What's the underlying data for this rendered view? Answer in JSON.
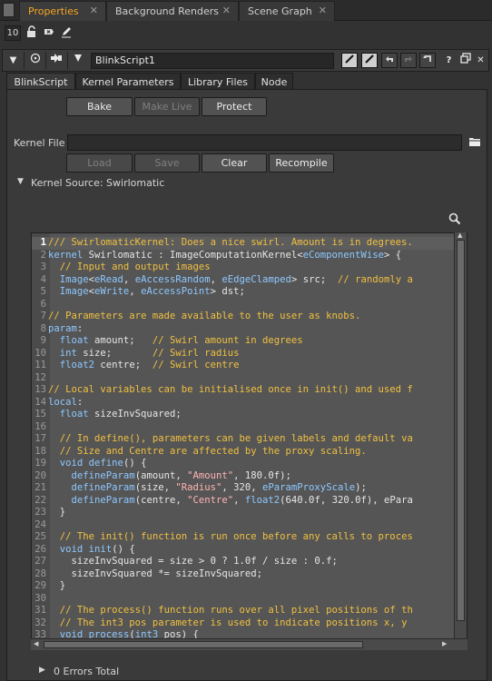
{
  "panel_tabs": [
    {
      "label": "Properties",
      "active": true
    },
    {
      "label": "Background Renders",
      "active": false
    },
    {
      "label": "Scene Graph",
      "active": false
    }
  ],
  "toolbar": {
    "max_panels": "10"
  },
  "node": {
    "name": "BlinkScript1"
  },
  "content_tabs": [
    "BlinkScript",
    "Kernel Parameters",
    "Library Files",
    "Node"
  ],
  "buttons": {
    "bake": "Bake",
    "make_live": "Make Live",
    "protect": "Protect",
    "load": "Load",
    "save": "Save",
    "clear": "Clear",
    "recompile": "Recompile"
  },
  "kernel_file": {
    "label": "Kernel File",
    "value": ""
  },
  "kernel_source": {
    "label": "Kernel Source: Swirlomatic"
  },
  "code_lines": [
    "/// SwirlomaticKernel: Does a nice swirl. Amount is in degrees.",
    "kernel Swirlomatic : ImageComputationKernel<eComponentWise> {",
    "  // Input and output images",
    "  Image<eRead, eAccessRandom, eEdgeClamped> src;  // randomly a",
    "  Image<eWrite, eAccessPoint> dst;",
    "",
    "// Parameters are made available to the user as knobs.",
    "param:",
    "  float amount;   // Swirl amount in degrees",
    "  int size;       // Swirl radius",
    "  float2 centre;  // Swirl centre",
    "",
    "// Local variables can be initialised once in init() and used f",
    "local:",
    "  float sizeInvSquared;",
    "",
    "  // In define(), parameters can be given labels and default va",
    "  // Size and Centre are affected by the proxy scaling.",
    "  void define() {",
    "    defineParam(amount, \"Amount\", 180.0f);",
    "    defineParam(size, \"Radius\", 320, eParamProxyScale);",
    "    defineParam(centre, \"Centre\", float2(640.0f, 320.0f), ePara",
    "  }",
    "",
    "  // The init() function is run once before any calls to proces",
    "  void init() {",
    "    sizeInvSquared = size > 0 ? 1.0f / size : 0.f;",
    "    sizeInvSquared *= sizeInvSquared;",
    "  }",
    "",
    "  // The process() function runs over all pixel positions of th",
    "  // The int3 pos parameter is used to indicate positions x, y",
    "  void process(int3 pos) {"
  ],
  "status": {
    "errors": "0 Errors Total"
  }
}
